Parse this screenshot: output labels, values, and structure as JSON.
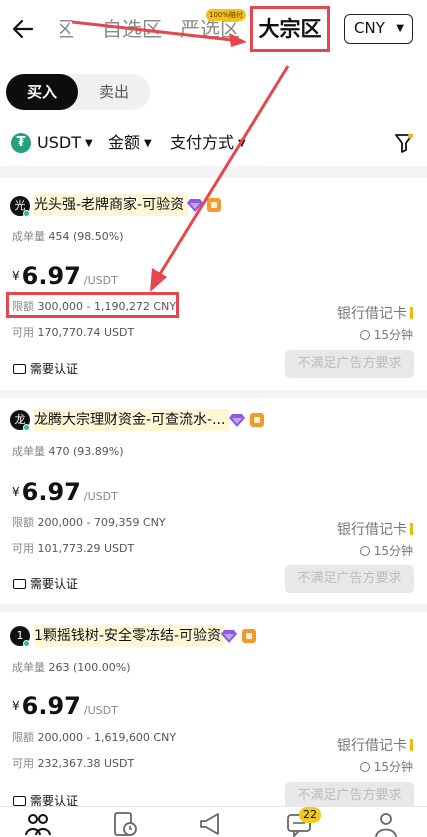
{
  "header": {
    "back_icon": "back-arrow-icon",
    "tabs": [
      {
        "label": "区",
        "state": "partial"
      },
      {
        "label": "自选区"
      },
      {
        "label": "严选区",
        "badge": "100%赔付"
      },
      {
        "label": "大宗区",
        "state": "active"
      }
    ],
    "currency": "CNY"
  },
  "mode": {
    "buy": "买入",
    "sell": "卖出",
    "selected": "buy"
  },
  "filters": {
    "crypto": "USDT",
    "amount": "金额",
    "payment": "支付方式",
    "filter_icon": "funnel-icon"
  },
  "ads": [
    {
      "avatar": "光",
      "merchant": "光头强-老牌商家-可验资",
      "orders_label": "成单量",
      "orders": "454 (98.50%)",
      "currency_symbol": "¥",
      "price": "6.97",
      "unit": "/USDT",
      "limit_label": "限额",
      "limit": "300,000 - 1,190,272 CNY",
      "available_label": "可用",
      "available": "170,770.74 USDT",
      "payment": "银行借记卡",
      "time": "15分钟",
      "verify": "需要认证",
      "button": "不满足广告方要求"
    },
    {
      "avatar": "龙",
      "merchant": "龙腾大宗理财资金-可查流水-...",
      "orders_label": "成单量",
      "orders": "470 (93.89%)",
      "currency_symbol": "¥",
      "price": "6.97",
      "unit": "/USDT",
      "limit_label": "限额",
      "limit": "200,000 - 709,359 CNY",
      "available_label": "可用",
      "available": "101,773.29 USDT",
      "payment": "银行借记卡",
      "time": "15分钟",
      "verify": "需要认证",
      "button": "不满足广告方要求"
    },
    {
      "avatar": "1",
      "merchant": "1颗摇钱树-安全零冻结-可验资",
      "orders_label": "成单量",
      "orders": "263 (100.00%)",
      "currency_symbol": "¥",
      "price": "6.97",
      "unit": "/USDT",
      "limit_label": "限额",
      "limit": "200,000 - 1,619,600 CNY",
      "available_label": "可用",
      "available": "232,367.38 USDT",
      "payment": "银行借记卡",
      "time": "15分钟",
      "verify": "需要认证",
      "button": "不满足广告方要求"
    }
  ],
  "bottom_nav": {
    "items": [
      "p2p-trade-icon",
      "orders-icon",
      "ads-icon",
      "chat-icon",
      "profile-icon"
    ],
    "chat_badge": "22"
  },
  "colors": {
    "annotation_red": "#e5474e",
    "tether_green": "#26a17b",
    "merchant_highlight": "#fdf7d6",
    "verified_purple": "#8f59e8",
    "shield_orange": "#f29a2e"
  }
}
